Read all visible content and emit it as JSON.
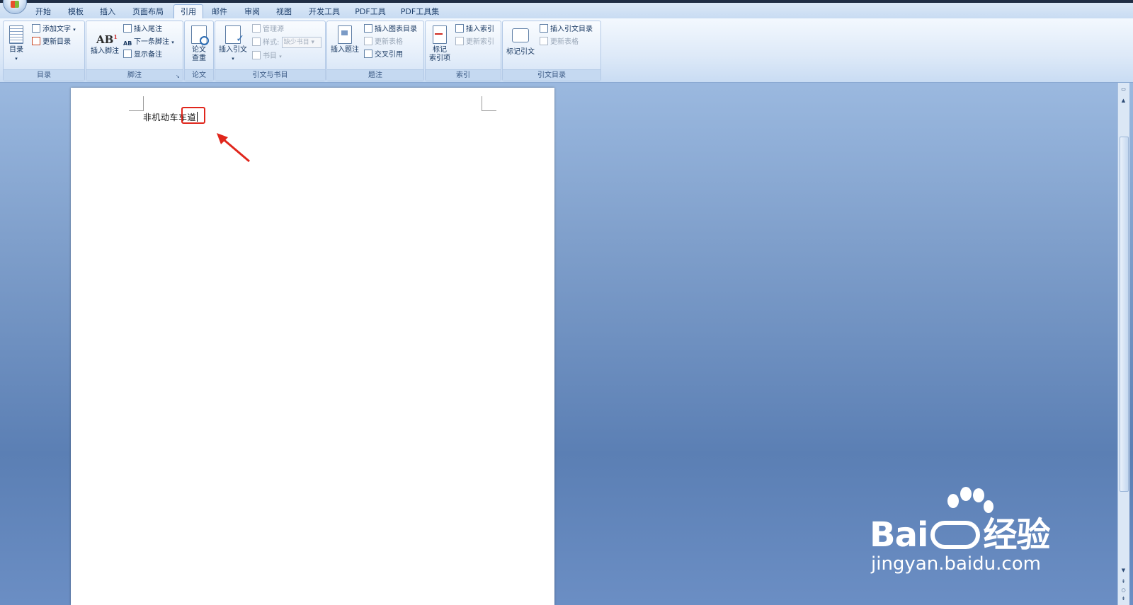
{
  "tabs": [
    {
      "label": "开始"
    },
    {
      "label": "模板"
    },
    {
      "label": "插入"
    },
    {
      "label": "页面布局"
    },
    {
      "label": "引用",
      "active": true
    },
    {
      "label": "邮件"
    },
    {
      "label": "审阅"
    },
    {
      "label": "视图"
    },
    {
      "label": "开发工具"
    },
    {
      "label": "PDF工具"
    },
    {
      "label": "PDF工具集"
    }
  ],
  "ribbon": {
    "toc": {
      "group_label": "目录",
      "toc_btn": "目录",
      "add_text": "添加文字",
      "update_toc": "更新目录"
    },
    "footnotes": {
      "group_label": "脚注",
      "insert_footnote": "插入脚注",
      "insert_endnote": "插入尾注",
      "next_footnote": "下一条脚注",
      "show_notes": "显示备注"
    },
    "thesis": {
      "group_label": "论文",
      "check_btn_1": "论文",
      "check_btn_2": "查重"
    },
    "citations": {
      "group_label": "引文与书目",
      "insert_citation": "插入引文",
      "manage_sources": "管理源",
      "style_label": "样式:",
      "style_value": "缺少书目",
      "bibliography": "书目"
    },
    "captions": {
      "group_label": "题注",
      "insert_caption": "插入题注",
      "insert_table_figures": "插入图表目录",
      "update_table": "更新表格",
      "cross_reference": "交叉引用"
    },
    "index": {
      "group_label": "索引",
      "mark_entry_1": "标记",
      "mark_entry_2": "索引项",
      "insert_index": "插入索引",
      "update_index": "更新索引"
    },
    "toa": {
      "group_label": "引文目录",
      "mark_citation": "标记引文",
      "insert_toa": "插入引文目录",
      "update_table": "更新表格"
    }
  },
  "document": {
    "text": "非机动车车道"
  },
  "watermark": {
    "brand": "Bai",
    "brand_cn": "经验",
    "url": "jingyan.baidu.com"
  },
  "colors": {
    "highlight": "#e0261c",
    "accent": "#15375c"
  }
}
